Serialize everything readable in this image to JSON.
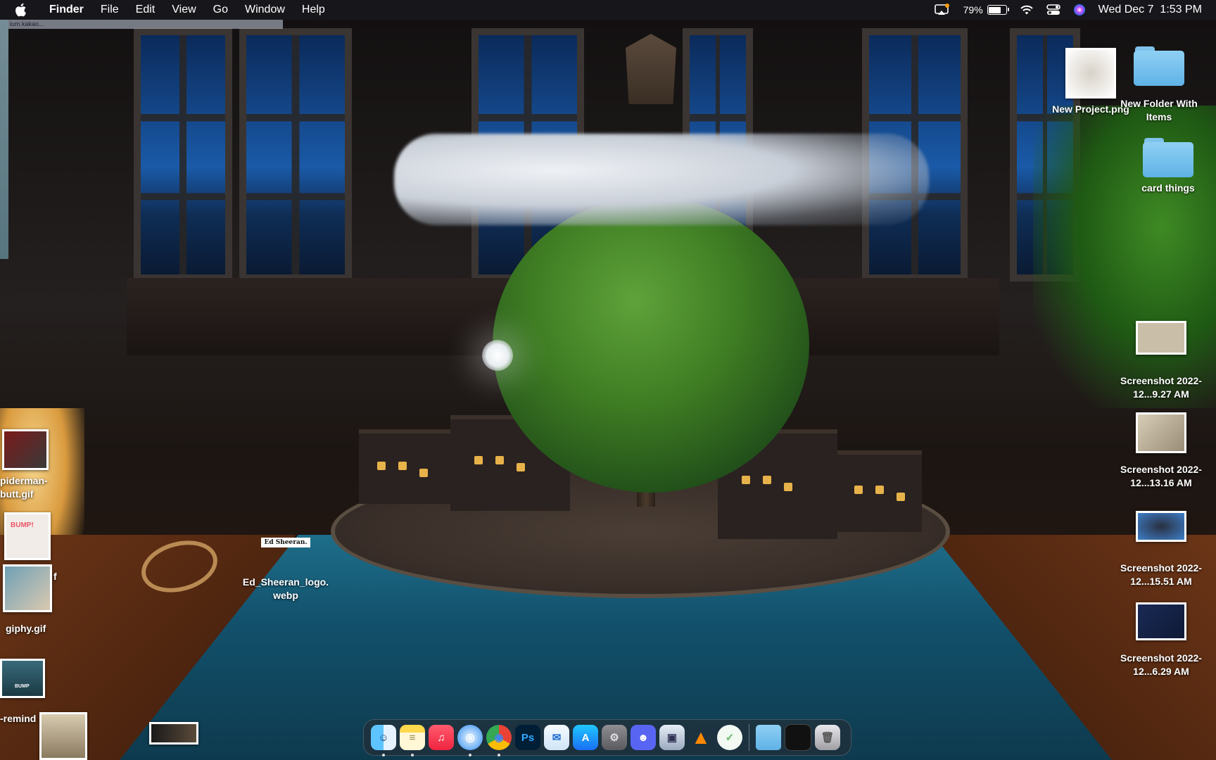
{
  "menubar": {
    "app_name": "Finder",
    "menus": [
      "File",
      "Edit",
      "View",
      "Go",
      "Window",
      "Help"
    ],
    "battery_percent": "79%",
    "battery_level": 0.79,
    "clock": "Wed Dec 7  1:53 PM"
  },
  "browser_ghost": {
    "url_fragment": "ium.kakao..."
  },
  "desktop": {
    "right_icons": [
      {
        "label": "New Project.png"
      },
      {
        "label": "New Folder With Items"
      },
      {
        "label": "card things"
      },
      {
        "label": "Screenshot 2022-12...9.27 AM"
      },
      {
        "label": "Screenshot 2022-12...13.16 AM"
      },
      {
        "label": "Screenshot 2022-12...15.51 AM"
      },
      {
        "label": "Screenshot 2022-12...6.29 AM"
      }
    ],
    "left_icons": [
      {
        "label": "piderman-\nbutt.gif"
      },
      {
        "label": "f"
      },
      {
        "label": "giphy.gif"
      },
      {
        "label": "BUMP"
      },
      {
        "label": "-remind"
      }
    ],
    "center_icons": [
      {
        "label": "Ed_Sheeran_logo.\nwebp",
        "thumb_text": "Ed Sheeran."
      }
    ],
    "sticker_text": "BUMP!"
  },
  "dock": {
    "apps": [
      {
        "name": "Finder",
        "icon": "finder-icon",
        "running": true,
        "glyph": "☺"
      },
      {
        "name": "Notes",
        "icon": "notes-icon",
        "running": true,
        "glyph": "≡"
      },
      {
        "name": "Music",
        "icon": "music-icon",
        "running": false,
        "glyph": "♫"
      },
      {
        "name": "Safari",
        "icon": "safari-icon",
        "running": true,
        "glyph": "◎"
      },
      {
        "name": "Chrome",
        "icon": "chrome-icon",
        "running": true,
        "glyph": "◉"
      },
      {
        "name": "Photoshop",
        "icon": "photoshop-icon",
        "running": false,
        "glyph": "Ps"
      },
      {
        "name": "Mail",
        "icon": "mail-icon",
        "running": false,
        "glyph": "✉"
      },
      {
        "name": "App Store",
        "icon": "app-store-icon",
        "running": false,
        "glyph": "A"
      },
      {
        "name": "System Settings",
        "icon": "settings-icon",
        "running": false,
        "glyph": "⚙"
      },
      {
        "name": "Discord",
        "icon": "discord-icon",
        "running": false,
        "glyph": "☻"
      },
      {
        "name": "Preview",
        "icon": "preview-icon",
        "running": false,
        "glyph": "▣"
      },
      {
        "name": "VLC",
        "icon": "vlc-icon",
        "running": false,
        "glyph": "▲"
      },
      {
        "name": "AdGuard",
        "icon": "shield-icon",
        "running": false,
        "glyph": "✓"
      },
      {
        "name": "Downloads",
        "icon": "folder-icon",
        "running": false,
        "glyph": ""
      },
      {
        "name": "Recent",
        "icon": "window-icon",
        "running": false,
        "glyph": ""
      },
      {
        "name": "Trash",
        "icon": "trash-icon",
        "running": false,
        "glyph": "🗑"
      }
    ]
  },
  "colors": {
    "menubar_bg": "#19191e",
    "folder_blue": "#5fb2e6",
    "photoshop": "#31a8ff"
  }
}
